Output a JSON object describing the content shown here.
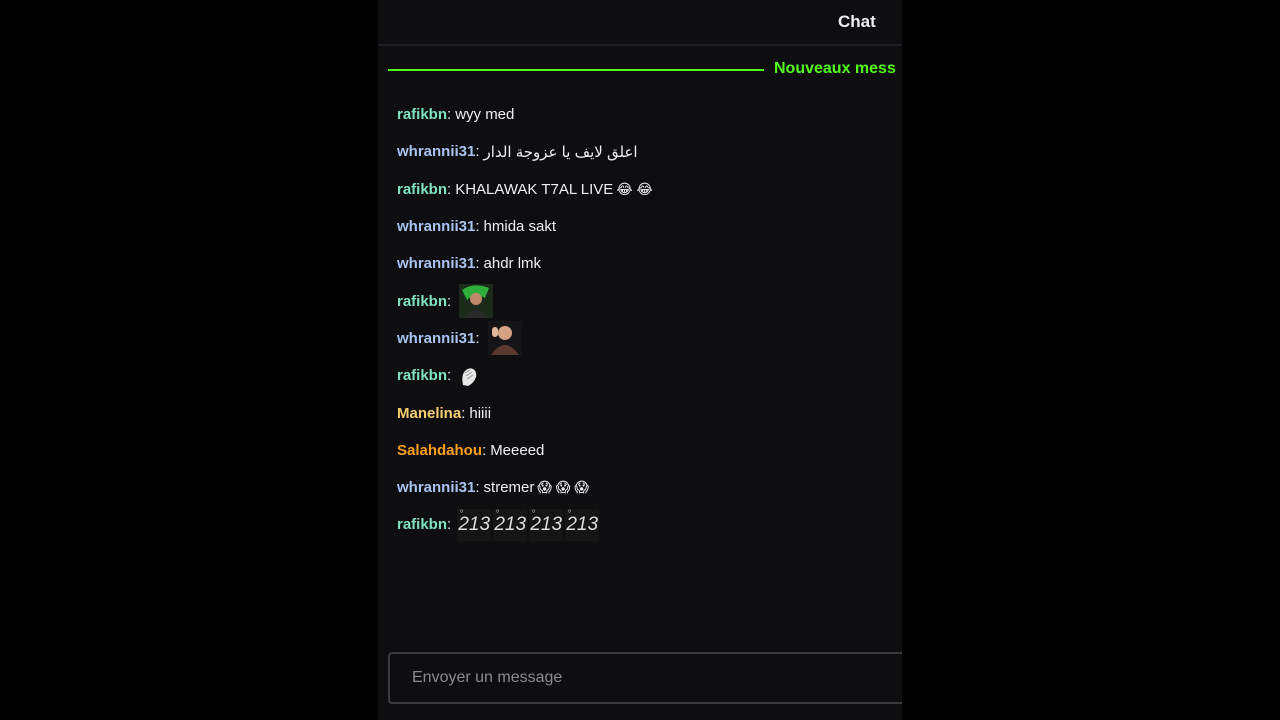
{
  "header": {
    "title": "Chat"
  },
  "divider": {
    "label": "Nouveaux mess"
  },
  "colors": {
    "accent_green": "#53fc18",
    "user_rafikbn": "#7fe3c0",
    "user_whrannii31": "#a7c4f2",
    "user_manelina": "#f7cf6f",
    "user_salahdahou": "#ff9f1a"
  },
  "messages": [
    {
      "user": "rafikbn",
      "text": "wyy med"
    },
    {
      "user": "whrannii31",
      "text": "اعلق لايف يا عزوجة الدار"
    },
    {
      "user": "rafikbn",
      "text": "KHALAWAK T7AL LIVE",
      "emoji": "😂 😂"
    },
    {
      "user": "whrannii31",
      "text": "hmida sakt"
    },
    {
      "user": "whrannii31",
      "text": "ahdr lmk"
    },
    {
      "user": "rafikbn",
      "emote": "portrait-emote"
    },
    {
      "user": "whrannii31",
      "emote": "person-emote"
    },
    {
      "user": "rafikbn",
      "emote": "hand-emote"
    },
    {
      "user": "Manelina",
      "text": "hiiii"
    },
    {
      "user": "Salahdahou",
      "text": "Meeeed"
    },
    {
      "user": "whrannii31",
      "text": "stremer",
      "emoji": "😱 😱 😱"
    },
    {
      "user": "rafikbn",
      "emote_tags": [
        "213",
        "213",
        "213",
        "213"
      ]
    }
  ],
  "input": {
    "placeholder": "Envoyer un message"
  }
}
